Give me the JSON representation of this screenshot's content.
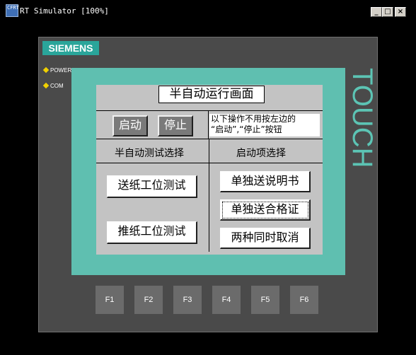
{
  "window": {
    "icon_text": "CFRT",
    "title": "RT Simulator [100%]",
    "minimize_label": "_",
    "maximize_label": "□",
    "close_label": "×"
  },
  "panel": {
    "brand": "SIEMENS",
    "leds": [
      {
        "label": "POWER"
      },
      {
        "label": "COM"
      }
    ],
    "touch_label": "TOUCH",
    "function_keys": [
      "F1",
      "F2",
      "F3",
      "F4",
      "F5",
      "F6"
    ]
  },
  "screen": {
    "title": "半自动运行画面",
    "start_button": "启动",
    "stop_button": "停止",
    "note_line1": "以下操作不用按左边的",
    "note_line2": "“启动”,“停止”按钮",
    "left_header": "半自动测试选择",
    "right_header": "启动项选择",
    "left_buttons": [
      "送纸工位测试",
      "推纸工位测试"
    ],
    "right_buttons": [
      "单独送说明书",
      "单独送合格证",
      "两种同时取消"
    ]
  },
  "colors": {
    "screen_frame": "#5fbfb0",
    "brand_bg": "#2aa59a",
    "led": "#f0d000"
  }
}
